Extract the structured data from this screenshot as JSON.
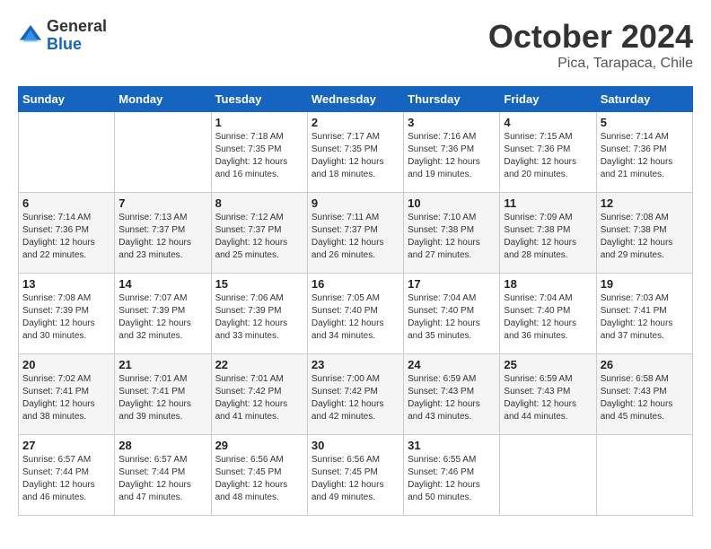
{
  "header": {
    "logo": {
      "general": "General",
      "blue": "Blue"
    },
    "title": "October 2024",
    "subtitle": "Pica, Tarapaca, Chile"
  },
  "calendar": {
    "weekdays": [
      "Sunday",
      "Monday",
      "Tuesday",
      "Wednesday",
      "Thursday",
      "Friday",
      "Saturday"
    ],
    "weeks": [
      [
        {
          "day": "",
          "info": ""
        },
        {
          "day": "",
          "info": ""
        },
        {
          "day": "1",
          "sunrise": "Sunrise: 7:18 AM",
          "sunset": "Sunset: 7:35 PM",
          "daylight": "Daylight: 12 hours and 16 minutes."
        },
        {
          "day": "2",
          "sunrise": "Sunrise: 7:17 AM",
          "sunset": "Sunset: 7:35 PM",
          "daylight": "Daylight: 12 hours and 18 minutes."
        },
        {
          "day": "3",
          "sunrise": "Sunrise: 7:16 AM",
          "sunset": "Sunset: 7:36 PM",
          "daylight": "Daylight: 12 hours and 19 minutes."
        },
        {
          "day": "4",
          "sunrise": "Sunrise: 7:15 AM",
          "sunset": "Sunset: 7:36 PM",
          "daylight": "Daylight: 12 hours and 20 minutes."
        },
        {
          "day": "5",
          "sunrise": "Sunrise: 7:14 AM",
          "sunset": "Sunset: 7:36 PM",
          "daylight": "Daylight: 12 hours and 21 minutes."
        }
      ],
      [
        {
          "day": "6",
          "sunrise": "Sunrise: 7:14 AM",
          "sunset": "Sunset: 7:36 PM",
          "daylight": "Daylight: 12 hours and 22 minutes."
        },
        {
          "day": "7",
          "sunrise": "Sunrise: 7:13 AM",
          "sunset": "Sunset: 7:37 PM",
          "daylight": "Daylight: 12 hours and 23 minutes."
        },
        {
          "day": "8",
          "sunrise": "Sunrise: 7:12 AM",
          "sunset": "Sunset: 7:37 PM",
          "daylight": "Daylight: 12 hours and 25 minutes."
        },
        {
          "day": "9",
          "sunrise": "Sunrise: 7:11 AM",
          "sunset": "Sunset: 7:37 PM",
          "daylight": "Daylight: 12 hours and 26 minutes."
        },
        {
          "day": "10",
          "sunrise": "Sunrise: 7:10 AM",
          "sunset": "Sunset: 7:38 PM",
          "daylight": "Daylight: 12 hours and 27 minutes."
        },
        {
          "day": "11",
          "sunrise": "Sunrise: 7:09 AM",
          "sunset": "Sunset: 7:38 PM",
          "daylight": "Daylight: 12 hours and 28 minutes."
        },
        {
          "day": "12",
          "sunrise": "Sunrise: 7:08 AM",
          "sunset": "Sunset: 7:38 PM",
          "daylight": "Daylight: 12 hours and 29 minutes."
        }
      ],
      [
        {
          "day": "13",
          "sunrise": "Sunrise: 7:08 AM",
          "sunset": "Sunset: 7:39 PM",
          "daylight": "Daylight: 12 hours and 30 minutes."
        },
        {
          "day": "14",
          "sunrise": "Sunrise: 7:07 AM",
          "sunset": "Sunset: 7:39 PM",
          "daylight": "Daylight: 12 hours and 32 minutes."
        },
        {
          "day": "15",
          "sunrise": "Sunrise: 7:06 AM",
          "sunset": "Sunset: 7:39 PM",
          "daylight": "Daylight: 12 hours and 33 minutes."
        },
        {
          "day": "16",
          "sunrise": "Sunrise: 7:05 AM",
          "sunset": "Sunset: 7:40 PM",
          "daylight": "Daylight: 12 hours and 34 minutes."
        },
        {
          "day": "17",
          "sunrise": "Sunrise: 7:04 AM",
          "sunset": "Sunset: 7:40 PM",
          "daylight": "Daylight: 12 hours and 35 minutes."
        },
        {
          "day": "18",
          "sunrise": "Sunrise: 7:04 AM",
          "sunset": "Sunset: 7:40 PM",
          "daylight": "Daylight: 12 hours and 36 minutes."
        },
        {
          "day": "19",
          "sunrise": "Sunrise: 7:03 AM",
          "sunset": "Sunset: 7:41 PM",
          "daylight": "Daylight: 12 hours and 37 minutes."
        }
      ],
      [
        {
          "day": "20",
          "sunrise": "Sunrise: 7:02 AM",
          "sunset": "Sunset: 7:41 PM",
          "daylight": "Daylight: 12 hours and 38 minutes."
        },
        {
          "day": "21",
          "sunrise": "Sunrise: 7:01 AM",
          "sunset": "Sunset: 7:41 PM",
          "daylight": "Daylight: 12 hours and 39 minutes."
        },
        {
          "day": "22",
          "sunrise": "Sunrise: 7:01 AM",
          "sunset": "Sunset: 7:42 PM",
          "daylight": "Daylight: 12 hours and 41 minutes."
        },
        {
          "day": "23",
          "sunrise": "Sunrise: 7:00 AM",
          "sunset": "Sunset: 7:42 PM",
          "daylight": "Daylight: 12 hours and 42 minutes."
        },
        {
          "day": "24",
          "sunrise": "Sunrise: 6:59 AM",
          "sunset": "Sunset: 7:43 PM",
          "daylight": "Daylight: 12 hours and 43 minutes."
        },
        {
          "day": "25",
          "sunrise": "Sunrise: 6:59 AM",
          "sunset": "Sunset: 7:43 PM",
          "daylight": "Daylight: 12 hours and 44 minutes."
        },
        {
          "day": "26",
          "sunrise": "Sunrise: 6:58 AM",
          "sunset": "Sunset: 7:43 PM",
          "daylight": "Daylight: 12 hours and 45 minutes."
        }
      ],
      [
        {
          "day": "27",
          "sunrise": "Sunrise: 6:57 AM",
          "sunset": "Sunset: 7:44 PM",
          "daylight": "Daylight: 12 hours and 46 minutes."
        },
        {
          "day": "28",
          "sunrise": "Sunrise: 6:57 AM",
          "sunset": "Sunset: 7:44 PM",
          "daylight": "Daylight: 12 hours and 47 minutes."
        },
        {
          "day": "29",
          "sunrise": "Sunrise: 6:56 AM",
          "sunset": "Sunset: 7:45 PM",
          "daylight": "Daylight: 12 hours and 48 minutes."
        },
        {
          "day": "30",
          "sunrise": "Sunrise: 6:56 AM",
          "sunset": "Sunset: 7:45 PM",
          "daylight": "Daylight: 12 hours and 49 minutes."
        },
        {
          "day": "31",
          "sunrise": "Sunrise: 6:55 AM",
          "sunset": "Sunset: 7:46 PM",
          "daylight": "Daylight: 12 hours and 50 minutes."
        },
        {
          "day": "",
          "info": ""
        },
        {
          "day": "",
          "info": ""
        }
      ]
    ]
  }
}
